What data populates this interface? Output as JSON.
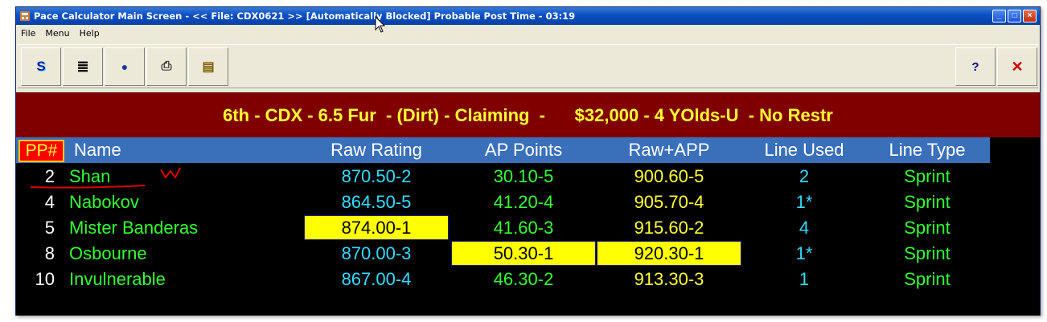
{
  "window": {
    "title": "Pace Calculator Main Screen - << File: CDX0621 >> [Automatically Blocked]   Probable Post Time - 03:19",
    "controls": {
      "minimize": "_",
      "maximize": "□",
      "close": "×"
    }
  },
  "menu": {
    "items": [
      "File",
      "Menu",
      "Help"
    ]
  },
  "toolbar": {
    "buttons": [
      {
        "icon": "s-letter-icon",
        "glyph": "S"
      },
      {
        "icon": "list-icon",
        "glyph": "≣"
      },
      {
        "icon": "globe-icon",
        "glyph": "●"
      },
      {
        "icon": "printer-icon",
        "glyph": "⎙"
      },
      {
        "icon": "document-icon",
        "glyph": "▤"
      }
    ],
    "help_glyph": "?",
    "close_glyph": "✕"
  },
  "race": {
    "header": "6th - CDX - 6.5 Fur  - (Dirt) - Claiming  -      $32,000 - 4 YOlds-U  - No Restr"
  },
  "grid": {
    "columns": {
      "pp": "PP#",
      "name": "Name",
      "raw_rating": "Raw Rating",
      "ap_points": "AP Points",
      "raw_app": "Raw+APP",
      "line_used": "Line Used",
      "line_type": "Line Type"
    },
    "rows": [
      {
        "pp": "2",
        "name": "Shan",
        "raw_rating": "870.50-2",
        "ap_points": "30.10-5",
        "raw_app": "900.60-5",
        "line_used": "2",
        "line_type": "Sprint"
      },
      {
        "pp": "4",
        "name": "Nabokov",
        "raw_rating": "864.50-5",
        "ap_points": "41.20-4",
        "raw_app": "905.70-4",
        "line_used": "1*",
        "line_type": "Sprint"
      },
      {
        "pp": "5",
        "name": "Mister Banderas",
        "raw_rating": "874.00-1",
        "ap_points": "41.60-3",
        "raw_app": "915.60-2",
        "line_used": "4",
        "line_type": "Sprint"
      },
      {
        "pp": "8",
        "name": "Osbourne",
        "raw_rating": "870.00-3",
        "ap_points": "50.30-1",
        "raw_app": "920.30-1",
        "line_used": "1*",
        "line_type": "Sprint"
      },
      {
        "pp": "10",
        "name": "Invulnerable",
        "raw_rating": "867.00-4",
        "ap_points": "46.30-2",
        "raw_app": "913.30-3",
        "line_used": "1",
        "line_type": "Sprint"
      }
    ],
    "highlighted": {
      "raw_rating_row": 2,
      "ap_points_row": 3,
      "raw_app_row": 3
    }
  },
  "colors": {
    "banner_bg": "#800000",
    "banner_text": "#ffff33",
    "header_bg": "#3a6fba",
    "grid_bg": "#000000",
    "highlight": "#ffff00",
    "annotation": "#e00000"
  }
}
